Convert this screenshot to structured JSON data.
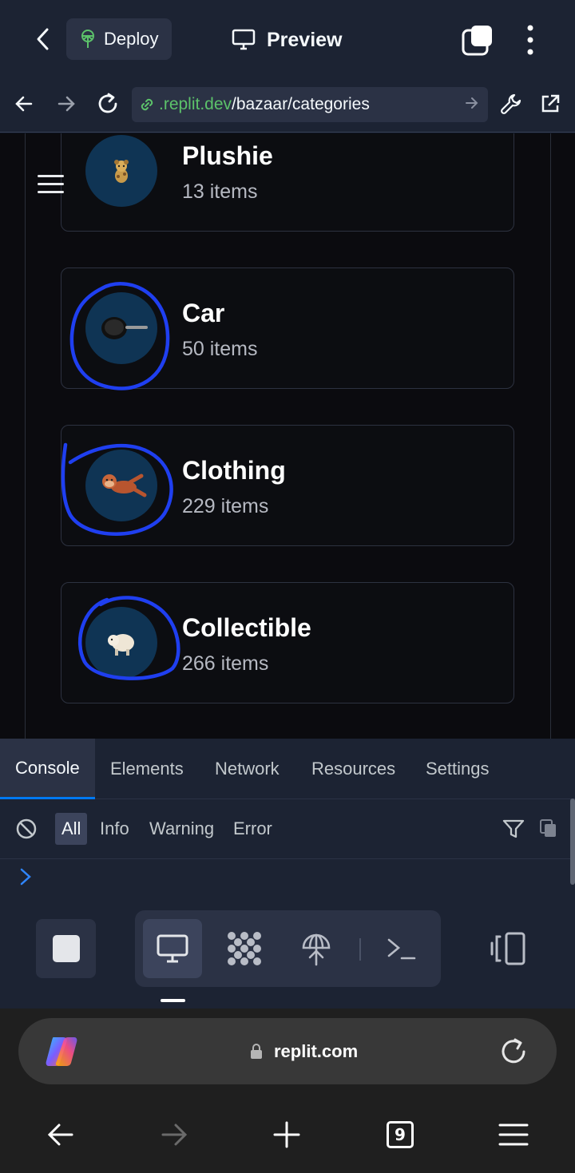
{
  "header": {
    "deploy_label": "Deploy",
    "preview_label": "Preview"
  },
  "urlbar": {
    "domain": ".replit.dev",
    "path": "/bazaar/categories"
  },
  "categories": [
    {
      "name": "Plushie",
      "count": "13 items",
      "icon": "plush-dog-icon",
      "annotated": false
    },
    {
      "name": "Car",
      "count": "50 items",
      "icon": "frying-pan-icon",
      "annotated": true
    },
    {
      "name": "Clothing",
      "count": "229 items",
      "icon": "toy-monkey-icon",
      "annotated": true
    },
    {
      "name": "Collectible",
      "count": "266 items",
      "icon": "toy-sheep-icon",
      "annotated": true
    }
  ],
  "devtools": {
    "tabs": [
      "Console",
      "Elements",
      "Network",
      "Resources",
      "Settings"
    ],
    "active_tab": "Console",
    "levels": [
      "All",
      "Info",
      "Warning",
      "Error"
    ],
    "active_level": "All"
  },
  "browser": {
    "host": "replit.com",
    "tab_count": "9"
  },
  "colors": {
    "replit_bg": "#1c2333",
    "accent_blue": "#0079f2",
    "annotation_blue": "#1f3ff0",
    "url_green": "#5cc26a"
  }
}
